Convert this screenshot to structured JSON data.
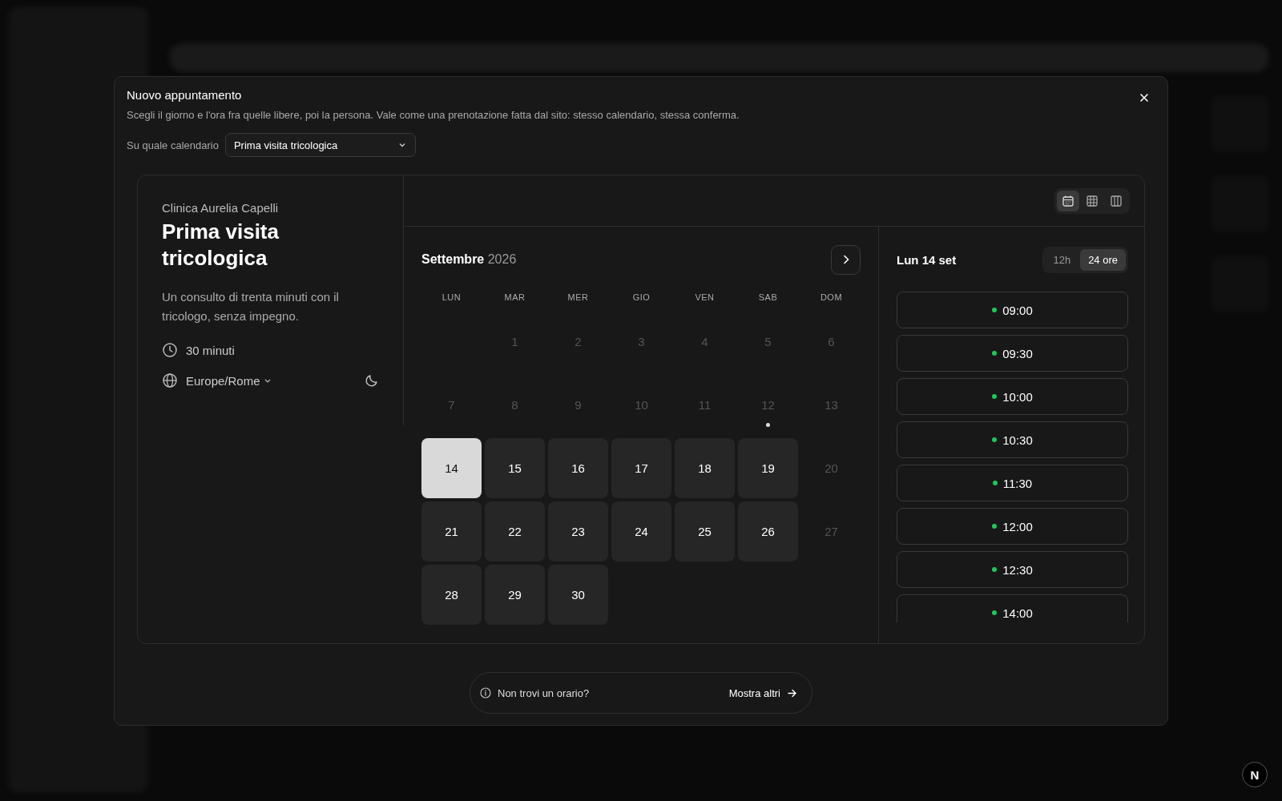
{
  "dialog": {
    "title": "Nuovo appuntamento",
    "subtitle": "Scegli il giorno e l'ora fra quelle libere, poi la persona. Vale come una prenotazione fatta dal sito: stesso calendario, stessa conferma.",
    "calendar_label": "Su quale calendario",
    "calendar_value": "Prima visita tricologica"
  },
  "event": {
    "organizer": "Clinica Aurelia Capelli",
    "title": "Prima visita tricologica",
    "description": "Un consulto di trenta minuti con il tricologo, senza impegno.",
    "duration": "30 minuti",
    "timezone": "Europe/Rome"
  },
  "views": [
    {
      "kind": "month",
      "selected": true
    },
    {
      "kind": "weekly",
      "selected": false
    },
    {
      "kind": "column",
      "selected": false
    }
  ],
  "month": {
    "name": "Settembre",
    "year": "2026",
    "weekdays": [
      "LUN",
      "MAR",
      "MER",
      "GIO",
      "VEN",
      "SAB",
      "DOM"
    ],
    "days": [
      {
        "label": "1",
        "available": false,
        "selected": false,
        "dot": false
      },
      {
        "label": "2",
        "available": false,
        "selected": false,
        "dot": false
      },
      {
        "label": "3",
        "available": false,
        "selected": false,
        "dot": false
      },
      {
        "label": "4",
        "available": false,
        "selected": false,
        "dot": false
      },
      {
        "label": "5",
        "available": false,
        "selected": false,
        "dot": false
      },
      {
        "label": "6",
        "available": false,
        "selected": false,
        "dot": false
      },
      {
        "label": "7",
        "available": false,
        "selected": false,
        "dot": false
      },
      {
        "label": "8",
        "available": false,
        "selected": false,
        "dot": false
      },
      {
        "label": "9",
        "available": false,
        "selected": false,
        "dot": false
      },
      {
        "label": "10",
        "available": false,
        "selected": false,
        "dot": false
      },
      {
        "label": "11",
        "available": false,
        "selected": false,
        "dot": false
      },
      {
        "label": "12",
        "available": false,
        "selected": false,
        "dot": true
      },
      {
        "label": "13",
        "available": false,
        "selected": false,
        "dot": false
      },
      {
        "label": "14",
        "available": true,
        "selected": true,
        "dot": false
      },
      {
        "label": "15",
        "available": true,
        "selected": false,
        "dot": false
      },
      {
        "label": "16",
        "available": true,
        "selected": false,
        "dot": false
      },
      {
        "label": "17",
        "available": true,
        "selected": false,
        "dot": false
      },
      {
        "label": "18",
        "available": true,
        "selected": false,
        "dot": false
      },
      {
        "label": "19",
        "available": true,
        "selected": false,
        "dot": false
      },
      {
        "label": "20",
        "available": false,
        "selected": false,
        "dot": false
      },
      {
        "label": "21",
        "available": true,
        "selected": false,
        "dot": false
      },
      {
        "label": "22",
        "available": true,
        "selected": false,
        "dot": false
      },
      {
        "label": "23",
        "available": true,
        "selected": false,
        "dot": false
      },
      {
        "label": "24",
        "available": true,
        "selected": false,
        "dot": false
      },
      {
        "label": "25",
        "available": true,
        "selected": false,
        "dot": false
      },
      {
        "label": "26",
        "available": true,
        "selected": false,
        "dot": false
      },
      {
        "label": "27",
        "available": false,
        "selected": false,
        "dot": false
      },
      {
        "label": "28",
        "available": true,
        "selected": false,
        "dot": false
      },
      {
        "label": "29",
        "available": true,
        "selected": false,
        "dot": false
      },
      {
        "label": "30",
        "available": true,
        "selected": false,
        "dot": false
      }
    ]
  },
  "slots": {
    "day": "Lun 14 set",
    "formats": [
      {
        "label": "12h",
        "selected": false
      },
      {
        "label": "24 ore",
        "selected": true
      }
    ],
    "times": [
      {
        "label": "09:00",
        "color": "#22c55e"
      },
      {
        "label": "09:30",
        "color": "#22c55e"
      },
      {
        "label": "10:00",
        "color": "#22c55e"
      },
      {
        "label": "10:30",
        "color": "#22c55e"
      },
      {
        "label": "11:30",
        "color": "#22c55e"
      },
      {
        "label": "12:00",
        "color": "#22c55e"
      },
      {
        "label": "12:30",
        "color": "#22c55e"
      },
      {
        "label": "14:00",
        "color": "#22c55e"
      }
    ]
  },
  "footer": {
    "hint": "Non trovi un orario?",
    "action": "Mostra altri"
  },
  "dev_badge": "N"
}
